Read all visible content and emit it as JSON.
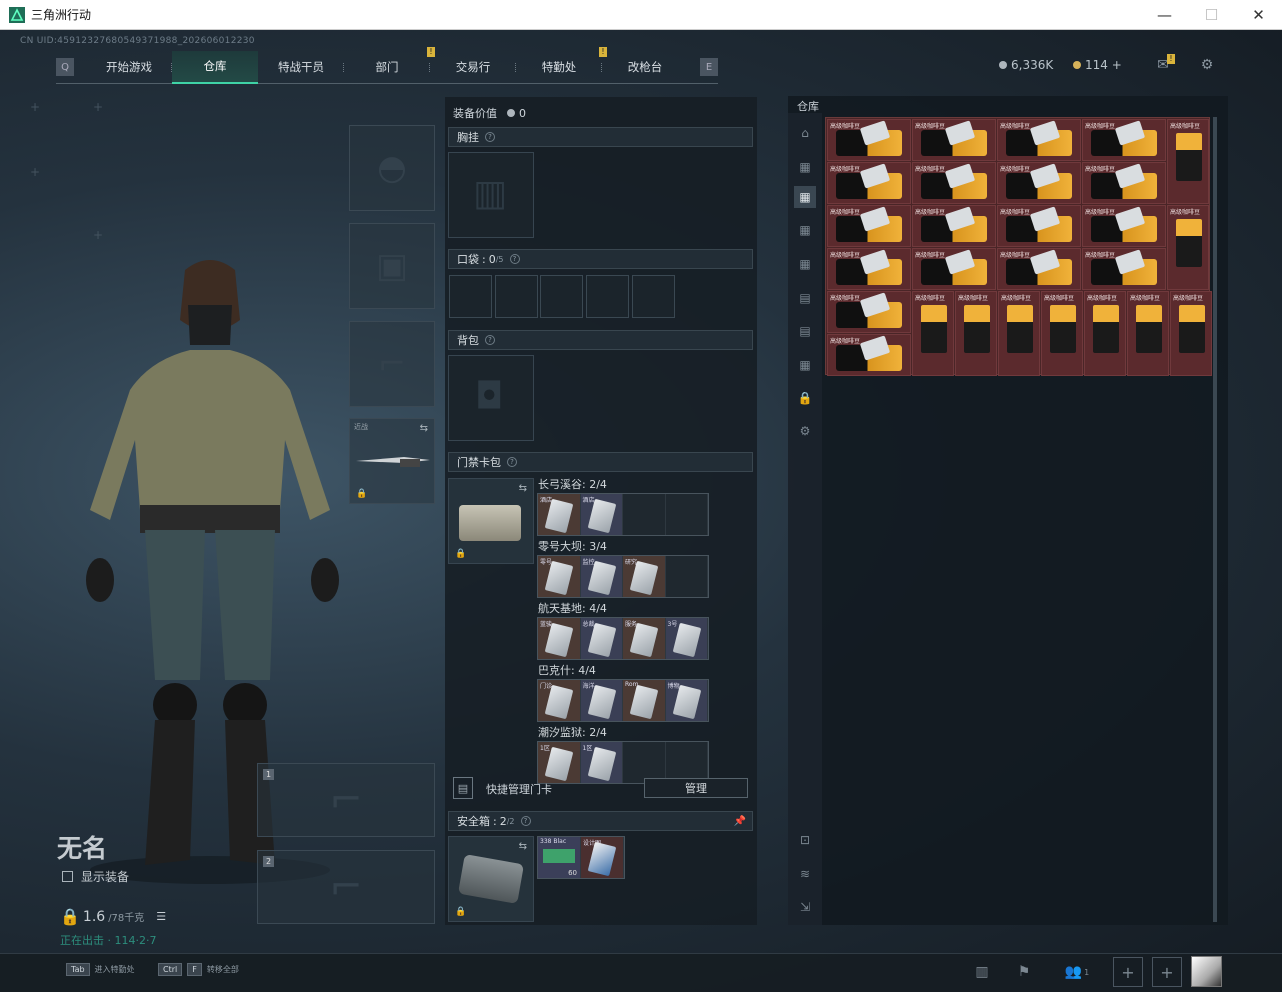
{
  "window": {
    "title": "三角洲行动"
  },
  "uid": "CN UID:459123276805493719​88_202606012230",
  "nav": {
    "tabs": [
      {
        "label": "开始游戏",
        "active": false,
        "alert": false
      },
      {
        "label": "仓库",
        "active": true,
        "alert": false
      },
      {
        "label": "特战干员",
        "active": false,
        "alert": false
      },
      {
        "label": "部门",
        "active": false,
        "alert": true
      },
      {
        "label": "交易行",
        "active": false,
        "alert": false
      },
      {
        "label": "特勤处",
        "active": false,
        "alert": true
      },
      {
        "label": "改枪台",
        "active": false,
        "alert": false
      }
    ],
    "prev_key": "Q",
    "next_key": "E"
  },
  "currency": {
    "silver": "6,336K",
    "gold": "114 +"
  },
  "player": {
    "name": "无名",
    "show_equipment": "显示装备",
    "weight": "1.6",
    "weight_unit": "/78千克",
    "sub_status": "正在出击 · 114·2·7"
  },
  "gear": {
    "melee_label": "近战",
    "weapon1_index": "1",
    "weapon2_index": "2"
  },
  "loadout": {
    "value_label": "装备价值",
    "value": "0",
    "chest_rig": "胸挂",
    "pockets": "口袋",
    "pockets_count": "0",
    "pockets_max": "/5",
    "backpack": "背包",
    "keycard_wallet": "门禁卡包",
    "keycard_rows": [
      {
        "label": "长弓溪谷: 2/4",
        "cards": [
          "酒店",
          "酒店"
        ],
        "empty": 2
      },
      {
        "label": "零号大坝: 3/4",
        "cards": [
          "零号",
          "监控",
          "研究"
        ],
        "empty": 1
      },
      {
        "label": "航天基地: 4/4",
        "cards": [
          "蓝骏",
          "总裁",
          "服务",
          "3号"
        ],
        "empty": 0
      },
      {
        "label": "巴克什: 4/4",
        "cards": [
          "门诊",
          "海洋",
          "Rom",
          "博物"
        ],
        "empty": 0
      },
      {
        "label": "潮汐监狱: 2/4",
        "cards": [
          "1区",
          "1区"
        ],
        "empty": 2
      }
    ],
    "quick_manage": "快捷管理门卡",
    "manage_button": "管理",
    "safe_box": "安全箱",
    "safe_box_count": "2",
    "safe_box_max": "/2",
    "safe_items": [
      {
        "label": "338 Blac",
        "qty": "60"
      },
      {
        "label": "设计图",
        "qty": ""
      }
    ]
  },
  "warehouse": {
    "title": "仓库",
    "item_label": "高级咖啡豆",
    "wide_rows": 6,
    "tall_item_count": 9
  },
  "bottom": {
    "hint1_key": "Tab",
    "hint1": "进入特勤处",
    "hint2_key1": "Ctrl",
    "hint2_key2": "F",
    "hint2": "转移全部",
    "friends_count": "1"
  },
  "colors": {
    "accent": "#3fd3a6",
    "alert": "#d9b43b",
    "grid_bg": "#5b2a2d"
  }
}
